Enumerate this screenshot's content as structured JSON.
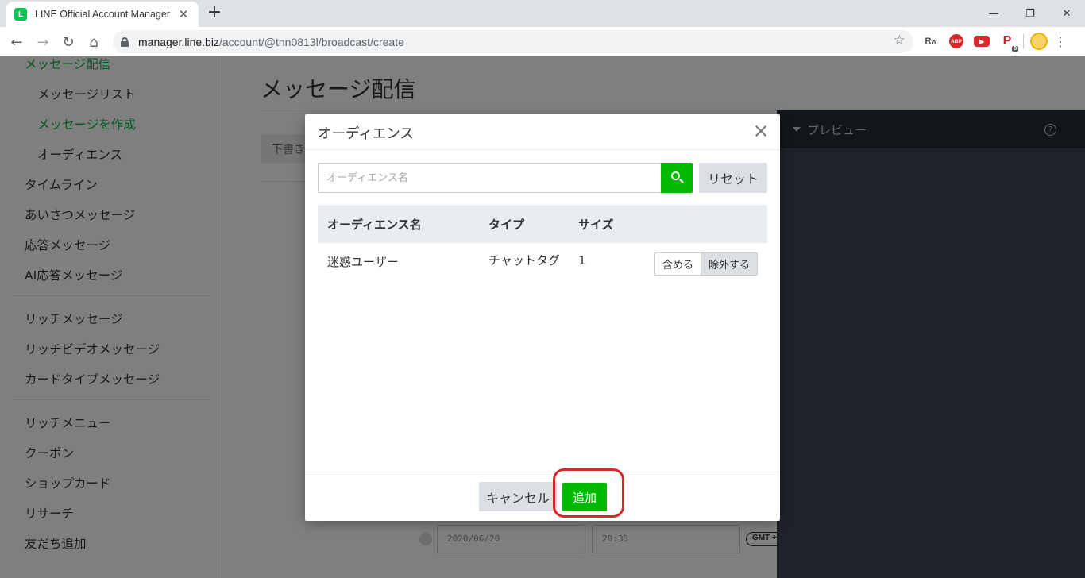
{
  "browser": {
    "tab_title": "LINE Official Account Manager",
    "favicon_letter": "L",
    "url_host": "manager.line.biz",
    "url_path": "/account/@tnn0813l/broadcast/create",
    "extension_badge": "8"
  },
  "sidebar": {
    "items": [
      {
        "label": "メッセージ配信"
      },
      {
        "label": "メッセージリスト"
      },
      {
        "label": "メッセージを作成"
      },
      {
        "label": "オーディエンス"
      },
      {
        "label": "タイムライン"
      },
      {
        "label": "あいさつメッセージ"
      },
      {
        "label": "応答メッセージ"
      },
      {
        "label": "AI応答メッセージ"
      },
      {
        "label": "リッチメッセージ"
      },
      {
        "label": "リッチビデオメッセージ"
      },
      {
        "label": "カードタイプメッセージ"
      },
      {
        "label": "リッチメニュー"
      },
      {
        "label": "クーポン"
      },
      {
        "label": "ショップカード"
      },
      {
        "label": "リサーチ"
      },
      {
        "label": "友だち追加"
      }
    ]
  },
  "main": {
    "page_title": "メッセージ配信",
    "draft_button": "下書き",
    "date_value": "2020/06/20",
    "time_value": "20:33",
    "timezone": "GMT +"
  },
  "preview": {
    "title": "プレビュー",
    "help": "?"
  },
  "modal": {
    "title": "オーディエンス",
    "search_placeholder": "オーディエンス名",
    "reset_label": "リセット",
    "columns": {
      "name": "オーディエンス名",
      "type": "タイプ",
      "size": "サイズ"
    },
    "rows": [
      {
        "name": "迷惑ユーザー",
        "type": "チャットタグ",
        "size": "1",
        "include_label": "含める",
        "exclude_label": "除外する"
      }
    ],
    "cancel_label": "キャンセル",
    "add_label": "追加"
  },
  "colors": {
    "accent_green": "#00b900",
    "annotation_red": "#d42a2a"
  }
}
